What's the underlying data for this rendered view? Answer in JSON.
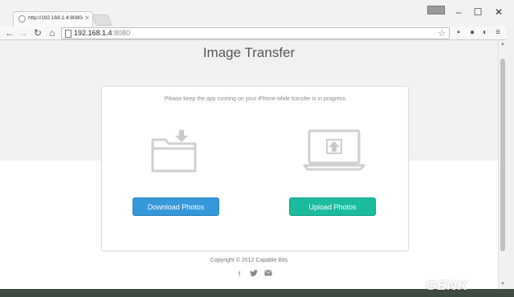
{
  "browser": {
    "tab_title": "http://192.168.1.4:8080/",
    "tab_close": "×",
    "url_host": "192.168.1.4",
    "url_port": ":8080",
    "window_badge": "",
    "minimize": "–",
    "maximize": "☐",
    "close": "✕"
  },
  "page": {
    "title": "Image Transfer",
    "instruction": "Please keep the app running on your iPhone while transfer is in progress.",
    "download_label": "Download Photos",
    "upload_label": "Upload Photos",
    "copyright": "Copyright © 2012 Capable Bits"
  },
  "icons": {
    "download": "folder-download-icon",
    "upload": "laptop-upload-icon",
    "social": [
      "facebook-icon",
      "twitter-icon",
      "email-icon"
    ]
  },
  "colors": {
    "download_button": "#3498db",
    "upload_button": "#1abc9c"
  },
  "watermark": "GENK"
}
